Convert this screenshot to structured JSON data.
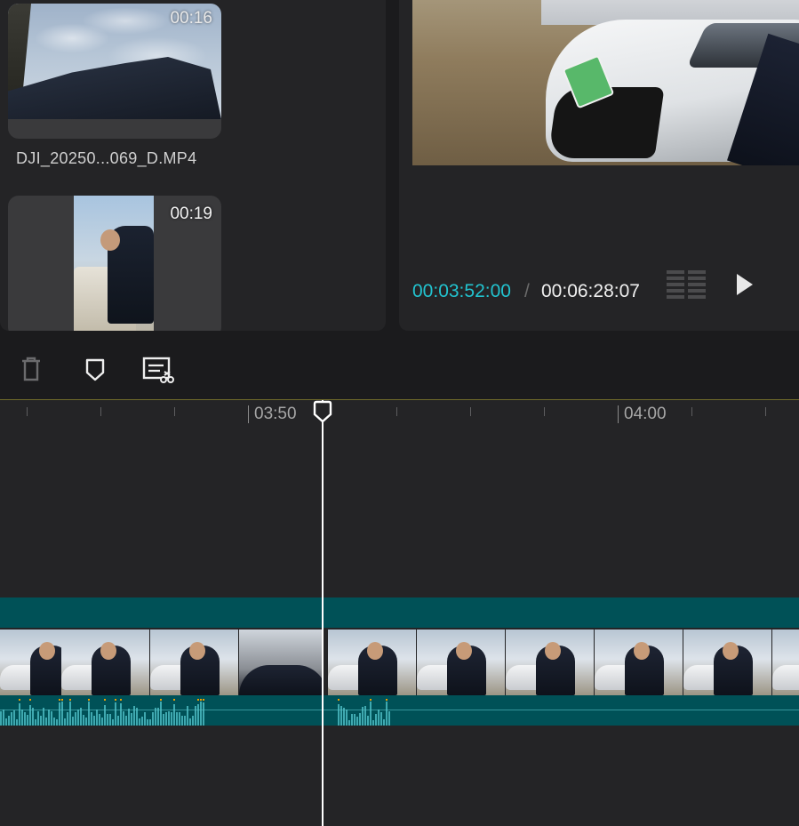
{
  "media_panel": {
    "clips": [
      {
        "duration": "00:16",
        "name": "DJI_20250...069_D.MP4"
      },
      {
        "duration": "00:19",
        "name": ""
      }
    ]
  },
  "preview": {
    "current_time": "00:03:52:00",
    "separator": "/",
    "total_time": "00:06:28:07",
    "icons": {
      "layout": "layout-grid-icon",
      "play": "play-icon"
    }
  },
  "toolbar": {
    "icons": [
      "trash-icon",
      "marker-icon",
      "split-icon"
    ]
  },
  "timeline": {
    "ruler_labels": [
      "03:50",
      "04:00"
    ],
    "colors": {
      "track": "#005157",
      "audio_bar": "#3fa9b0",
      "audio_peak": "#f0a000",
      "accent": "#22c3cf"
    }
  }
}
